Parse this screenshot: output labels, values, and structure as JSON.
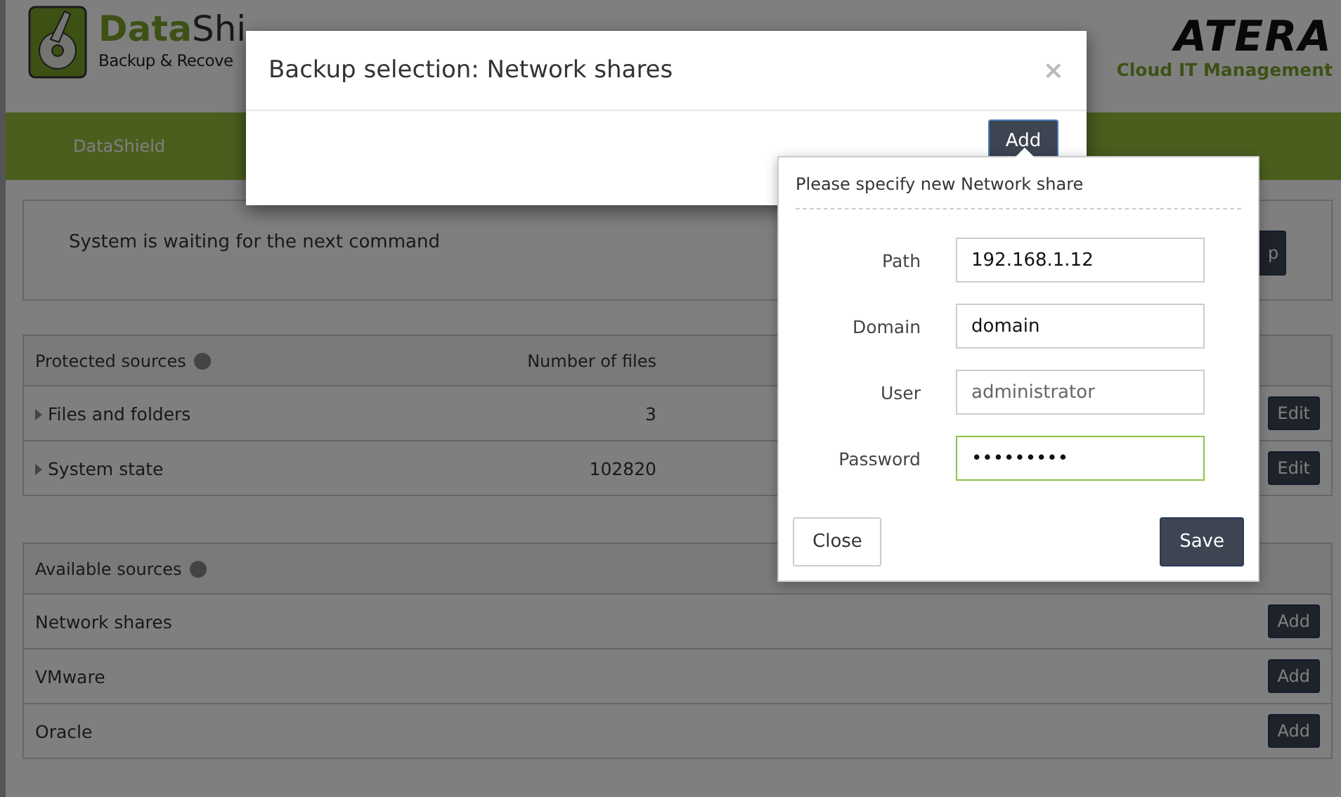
{
  "header": {
    "logo": {
      "brand_bold": "Data",
      "brand_rest": "Shi",
      "tagline": "Backup & Recove"
    },
    "partner_logo": {
      "name": "ATERA",
      "tagline": "Cloud IT Management"
    }
  },
  "nav": {
    "items": [
      {
        "label": "DataShield"
      }
    ]
  },
  "status": {
    "message": "System is waiting for the next command",
    "button": "p"
  },
  "protected_sources": {
    "columns": [
      "Protected sources",
      "Number of files"
    ],
    "rows": [
      {
        "name": "Files and folders",
        "files": "3",
        "action": "Edit"
      },
      {
        "name": "System state",
        "files": "102820",
        "action": "Edit"
      }
    ]
  },
  "available_sources": {
    "title": "Available sources",
    "rows": [
      {
        "name": "Network shares",
        "action": "Add"
      },
      {
        "name": "VMware",
        "action": "Add"
      },
      {
        "name": "Oracle",
        "action": "Add"
      }
    ]
  },
  "modal": {
    "title": "Backup selection: Network shares",
    "close": "×",
    "add_button": "Add"
  },
  "popover": {
    "title": "Please specify new Network share",
    "fields": [
      {
        "label": "Path",
        "value": "192.168.1.12",
        "focused": false
      },
      {
        "label": "Domain",
        "value": "domain",
        "focused": false
      },
      {
        "label": "User",
        "placeholder": "administrator",
        "focused": false
      },
      {
        "label": "Password",
        "value": "•••••••••",
        "focused": true
      }
    ],
    "buttons": [
      {
        "label": "Close",
        "kind": "secondary"
      },
      {
        "label": "Save",
        "kind": "primary"
      }
    ]
  }
}
